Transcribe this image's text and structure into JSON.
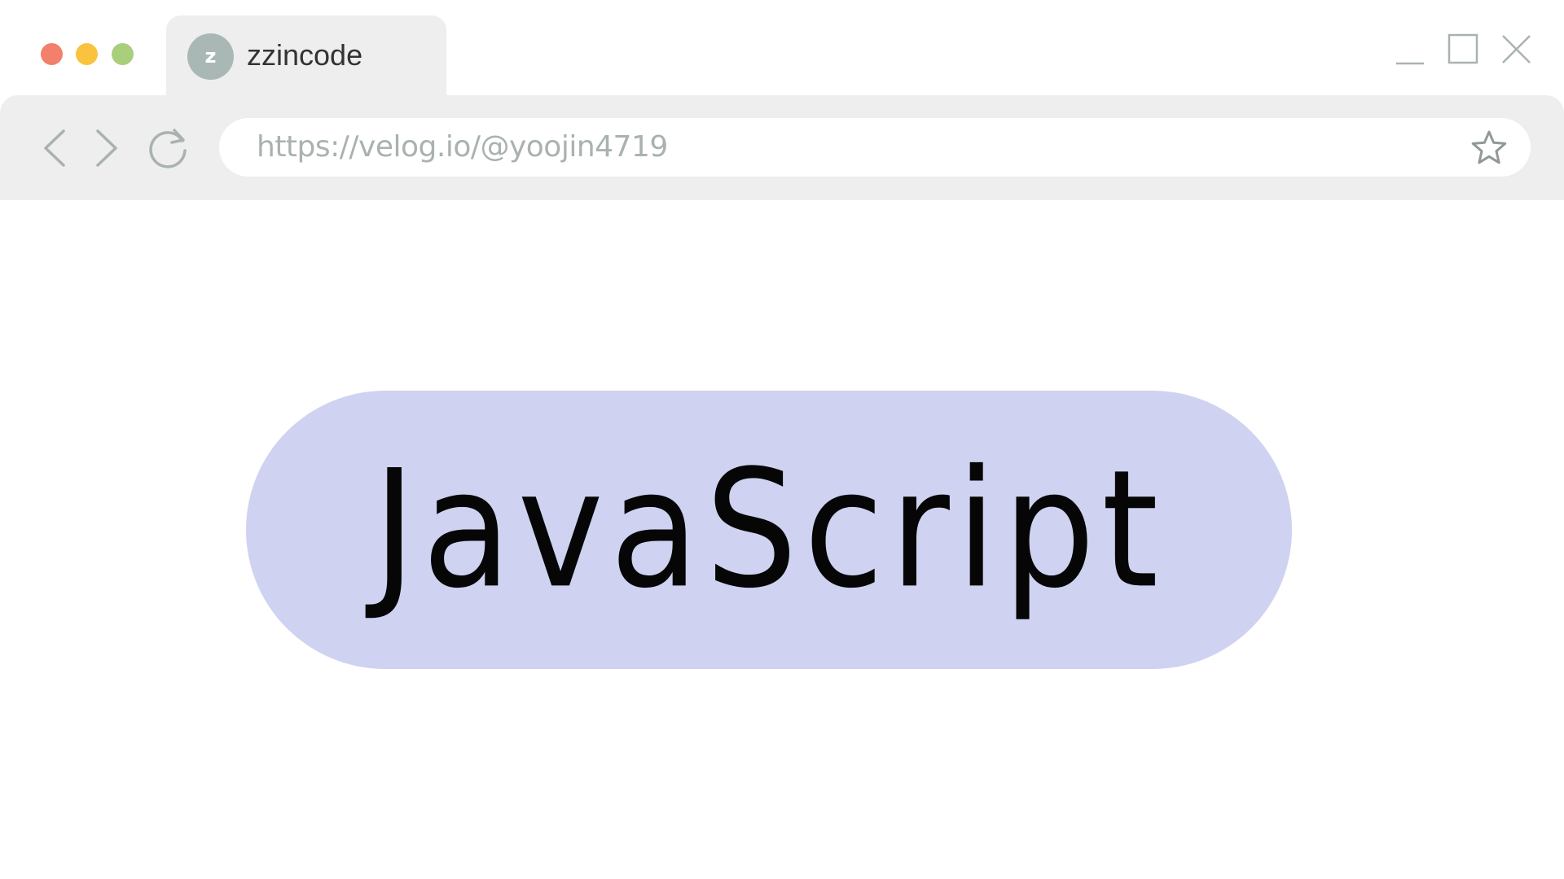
{
  "window": {
    "tab": {
      "avatar_letter": "z",
      "title": "zzincode"
    },
    "controls": {
      "minimize_icon": "minimize-icon",
      "maximize_icon": "maximize-icon",
      "close_icon": "close-icon"
    },
    "traffic_lights": {
      "close_color": "#f2806a",
      "minimize_color": "#fac33f",
      "zoom_color": "#a9cf7c"
    }
  },
  "toolbar": {
    "back_icon": "chevron-left-icon",
    "forward_icon": "chevron-right-icon",
    "reload_icon": "reload-icon",
    "url": "https://velog.io/@yoojin4719",
    "bookmark_icon": "star-icon"
  },
  "content": {
    "badge_label": "JavaScript",
    "badge_color": "#cfd2f0"
  }
}
